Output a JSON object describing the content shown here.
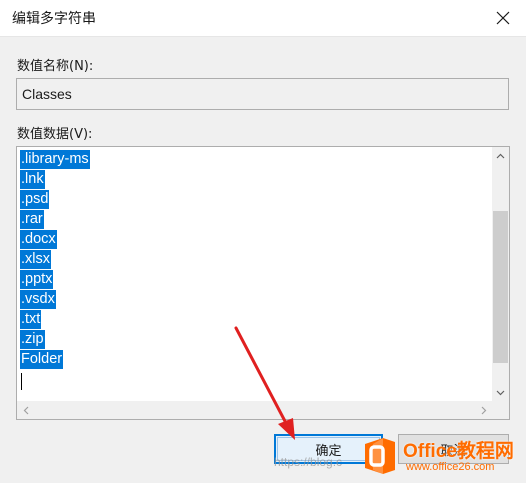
{
  "dialog": {
    "title": "编辑多字符串"
  },
  "value_name": {
    "label": "数值名称(N):",
    "value": "Classes"
  },
  "value_data": {
    "label": "数值数据(V):",
    "lines": [
      ".library-ms",
      ".lnk",
      ".psd",
      ".rar",
      ".docx",
      ".xlsx",
      ".pptx",
      ".vsdx",
      ".txt",
      ".zip",
      "Folder"
    ]
  },
  "buttons": {
    "ok": "确定",
    "cancel": "取消"
  },
  "watermark": {
    "url_text": "https://blog.c",
    "brand_text": "Office教程网",
    "site": "www.office26.com"
  },
  "colors": {
    "selection": "#0078d7",
    "annotation_arrow": "#e02020",
    "brand": "#ff6c00"
  }
}
